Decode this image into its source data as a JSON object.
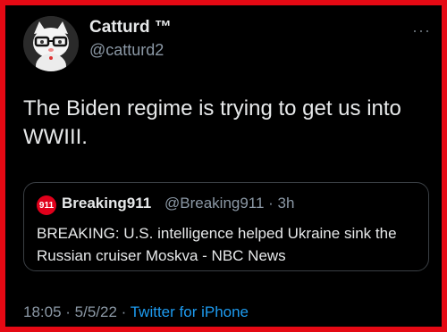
{
  "tweet": {
    "author_name": "Catturd ™",
    "author_handle": "@catturd2",
    "more_glyph": "···",
    "text": "The Biden regime is trying to get us into WWIII.",
    "timestamp": "18:05 · 5/5/22 ·",
    "source": "Twitter for iPhone"
  },
  "quote": {
    "logo_text": "911",
    "author_name": "Breaking911",
    "meta": "@Breaking911 · 3h",
    "text": "BREAKING: U.S. intelligence helped Ukraine sink the Russian cruiser Moskva - NBC News"
  },
  "colors": {
    "border": "#e50914",
    "background": "#000000",
    "link": "#1d9bf0",
    "muted": "#8b98a5"
  }
}
